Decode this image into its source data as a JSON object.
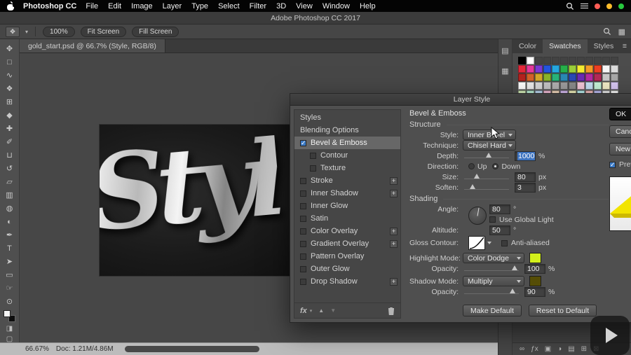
{
  "menu": {
    "app_name": "Photoshop CC",
    "items": [
      "File",
      "Edit",
      "Image",
      "Layer",
      "Type",
      "Select",
      "Filter",
      "3D",
      "View",
      "Window",
      "Help"
    ]
  },
  "window": {
    "title": "Adobe Photoshop CC 2017"
  },
  "options_bar": {
    "zoom": "100%",
    "fit_screen": "Fit Screen",
    "fill_screen": "Fill Screen"
  },
  "document": {
    "tab": "gold_start.psd @ 66.7% (Style, RGB/8)",
    "canvas_text": "Styl"
  },
  "tools": [
    {
      "name": "move-tool",
      "glyph": "✥"
    },
    {
      "name": "marquee-tool",
      "glyph": "□"
    },
    {
      "name": "lasso-tool",
      "glyph": "∿"
    },
    {
      "name": "quick-selection-tool",
      "glyph": "❖"
    },
    {
      "name": "crop-tool",
      "glyph": "⊞"
    },
    {
      "name": "eyedropper-tool",
      "glyph": "◆"
    },
    {
      "name": "healing-brush-tool",
      "glyph": "✚"
    },
    {
      "name": "brush-tool",
      "glyph": "✐"
    },
    {
      "name": "clone-stamp-tool",
      "glyph": "⊔"
    },
    {
      "name": "history-brush-tool",
      "glyph": "↺"
    },
    {
      "name": "eraser-tool",
      "glyph": "▱"
    },
    {
      "name": "gradient-tool",
      "glyph": "▥"
    },
    {
      "name": "blur-tool",
      "glyph": "◍"
    },
    {
      "name": "dodge-tool",
      "glyph": "◐"
    },
    {
      "name": "pen-tool",
      "glyph": "✒"
    },
    {
      "name": "type-tool",
      "glyph": "T"
    },
    {
      "name": "path-selection-tool",
      "glyph": "➤"
    },
    {
      "name": "shape-tool",
      "glyph": "▭"
    },
    {
      "name": "hand-tool",
      "glyph": "☞"
    },
    {
      "name": "zoom-tool",
      "glyph": "⊙"
    }
  ],
  "panels": {
    "tabs": [
      "Color",
      "Swatches",
      "Styles"
    ],
    "active_tab": "Swatches",
    "dock_icons": [
      {
        "name": "dock-panel-icon-1",
        "glyph": "▤"
      },
      {
        "name": "dock-panel-icon-2",
        "glyph": "▦"
      }
    ],
    "swatches": [
      [
        "#000000",
        "#ffffff",
        null,
        null,
        null,
        null,
        null,
        null,
        null,
        null,
        null,
        null
      ],
      [
        "#e3293a",
        "#e6399b",
        "#7d3bd4",
        "#2456e0",
        "#26a8e0",
        "#27b04b",
        "#9bcf3a",
        "#f5ec32",
        "#f59c28",
        "#ef4023",
        "#f7f7f7",
        "#dcdcdc"
      ],
      [
        "#b5231f",
        "#d4622a",
        "#d4a72a",
        "#8ab52a",
        "#2ab57a",
        "#2a8ab5",
        "#2a49b5",
        "#6b2ab5",
        "#b52aa0",
        "#b52a57",
        "#c9c9c9",
        "#a8a8a8"
      ],
      [
        "#ffffff",
        "#ececec",
        "#d9d9d9",
        "#c5c5c5",
        "#b1b1b1",
        "#9d9d9d",
        "#8a8a8a",
        "#f4c7d8",
        "#c7e0f4",
        "#c7f4d8",
        "#f4edc7",
        "#d8c7f4"
      ],
      [
        "#d2ecb8",
        "#b8ecd2",
        "#b8d2ec",
        "#ecb8d2",
        "#ecd2b8",
        "#d2b8ec",
        "#ececb8",
        "#b8ecec",
        "#ecb8b8",
        "#b8b8ec",
        "#e3e3e3",
        "#f5f5f5"
      ]
    ]
  },
  "dialog": {
    "title": "Layer Style",
    "styles_list": [
      {
        "label": "Styles",
        "type": "plain"
      },
      {
        "label": "Blending Options",
        "type": "plain"
      },
      {
        "label": "Bevel & Emboss",
        "checked": true,
        "selected": true
      },
      {
        "label": "Contour",
        "checked": false,
        "indent": true
      },
      {
        "label": "Texture",
        "checked": false,
        "indent": true
      },
      {
        "label": "Stroke",
        "checked": false,
        "plus": true
      },
      {
        "label": "Inner Shadow",
        "checked": false,
        "plus": true
      },
      {
        "label": "Inner Glow",
        "checked": false
      },
      {
        "label": "Satin",
        "checked": false
      },
      {
        "label": "Color Overlay",
        "checked": false,
        "plus": true
      },
      {
        "label": "Gradient Overlay",
        "checked": false,
        "plus": true
      },
      {
        "label": "Pattern Overlay",
        "checked": false
      },
      {
        "label": "Outer Glow",
        "checked": false
      },
      {
        "label": "Drop Shadow",
        "checked": false,
        "plus": true
      }
    ],
    "section_title": "Bevel & Emboss",
    "structure": {
      "heading": "Structure",
      "style_label": "Style:",
      "style_value": "Inner Bevel",
      "technique_label": "Technique:",
      "technique_value": "Chisel Hard",
      "depth_label": "Depth:",
      "depth_value": "1000",
      "depth_unit": "%",
      "depth_percent": 55,
      "direction_label": "Direction:",
      "direction_up": "Up",
      "direction_down": "Down",
      "direction_selected": "Down",
      "size_label": "Size:",
      "size_value": "80",
      "size_unit": "px",
      "size_percent": 28,
      "soften_label": "Soften:",
      "soften_value": "3",
      "soften_unit": "px",
      "soften_percent": 18
    },
    "shading": {
      "heading": "Shading",
      "angle_label": "Angle:",
      "angle_value": "80",
      "angle_unit": "°",
      "use_global_light": "Use Global Light",
      "altitude_label": "Altitude:",
      "altitude_value": "50",
      "altitude_unit": "°",
      "gloss_label": "Gloss Contour:",
      "anti_aliased": "Anti-aliased",
      "highlight_label": "Highlight Mode:",
      "highlight_value": "Color Dodge",
      "highlight_color": "#d2ef1b",
      "opacity1_label": "Opacity:",
      "opacity1_value": "100",
      "opacity1_unit": "%",
      "opacity1_percent": 92,
      "shadow_label": "Shadow Mode:",
      "shadow_value": "Multiply",
      "shadow_color": "#554d06",
      "opacity2_label": "Opacity:",
      "opacity2_value": "90",
      "opacity2_unit": "%",
      "opacity2_percent": 88
    },
    "footer": {
      "fx_label": "fx"
    },
    "buttons": {
      "make_default": "Make Default",
      "reset": "Reset to Default",
      "ok": "OK",
      "cancel": "Cancel",
      "new_style": "New Style...",
      "preview": "Preview"
    }
  },
  "layers_bar": {
    "icons": [
      {
        "name": "link-layers-icon",
        "glyph": "∞"
      },
      {
        "name": "layer-effects-icon",
        "glyph": "ƒx"
      },
      {
        "name": "layer-mask-icon",
        "glyph": "▣"
      },
      {
        "name": "adjustment-layer-icon",
        "glyph": "◑"
      },
      {
        "name": "layer-group-icon",
        "glyph": "▤"
      },
      {
        "name": "new-layer-icon",
        "glyph": "⊞"
      },
      {
        "name": "delete-layer-icon",
        "glyph": "⊠"
      }
    ]
  },
  "status_bar": {
    "zoom": "66.67%",
    "doc": "Doc: 1.21M/4.86M"
  }
}
